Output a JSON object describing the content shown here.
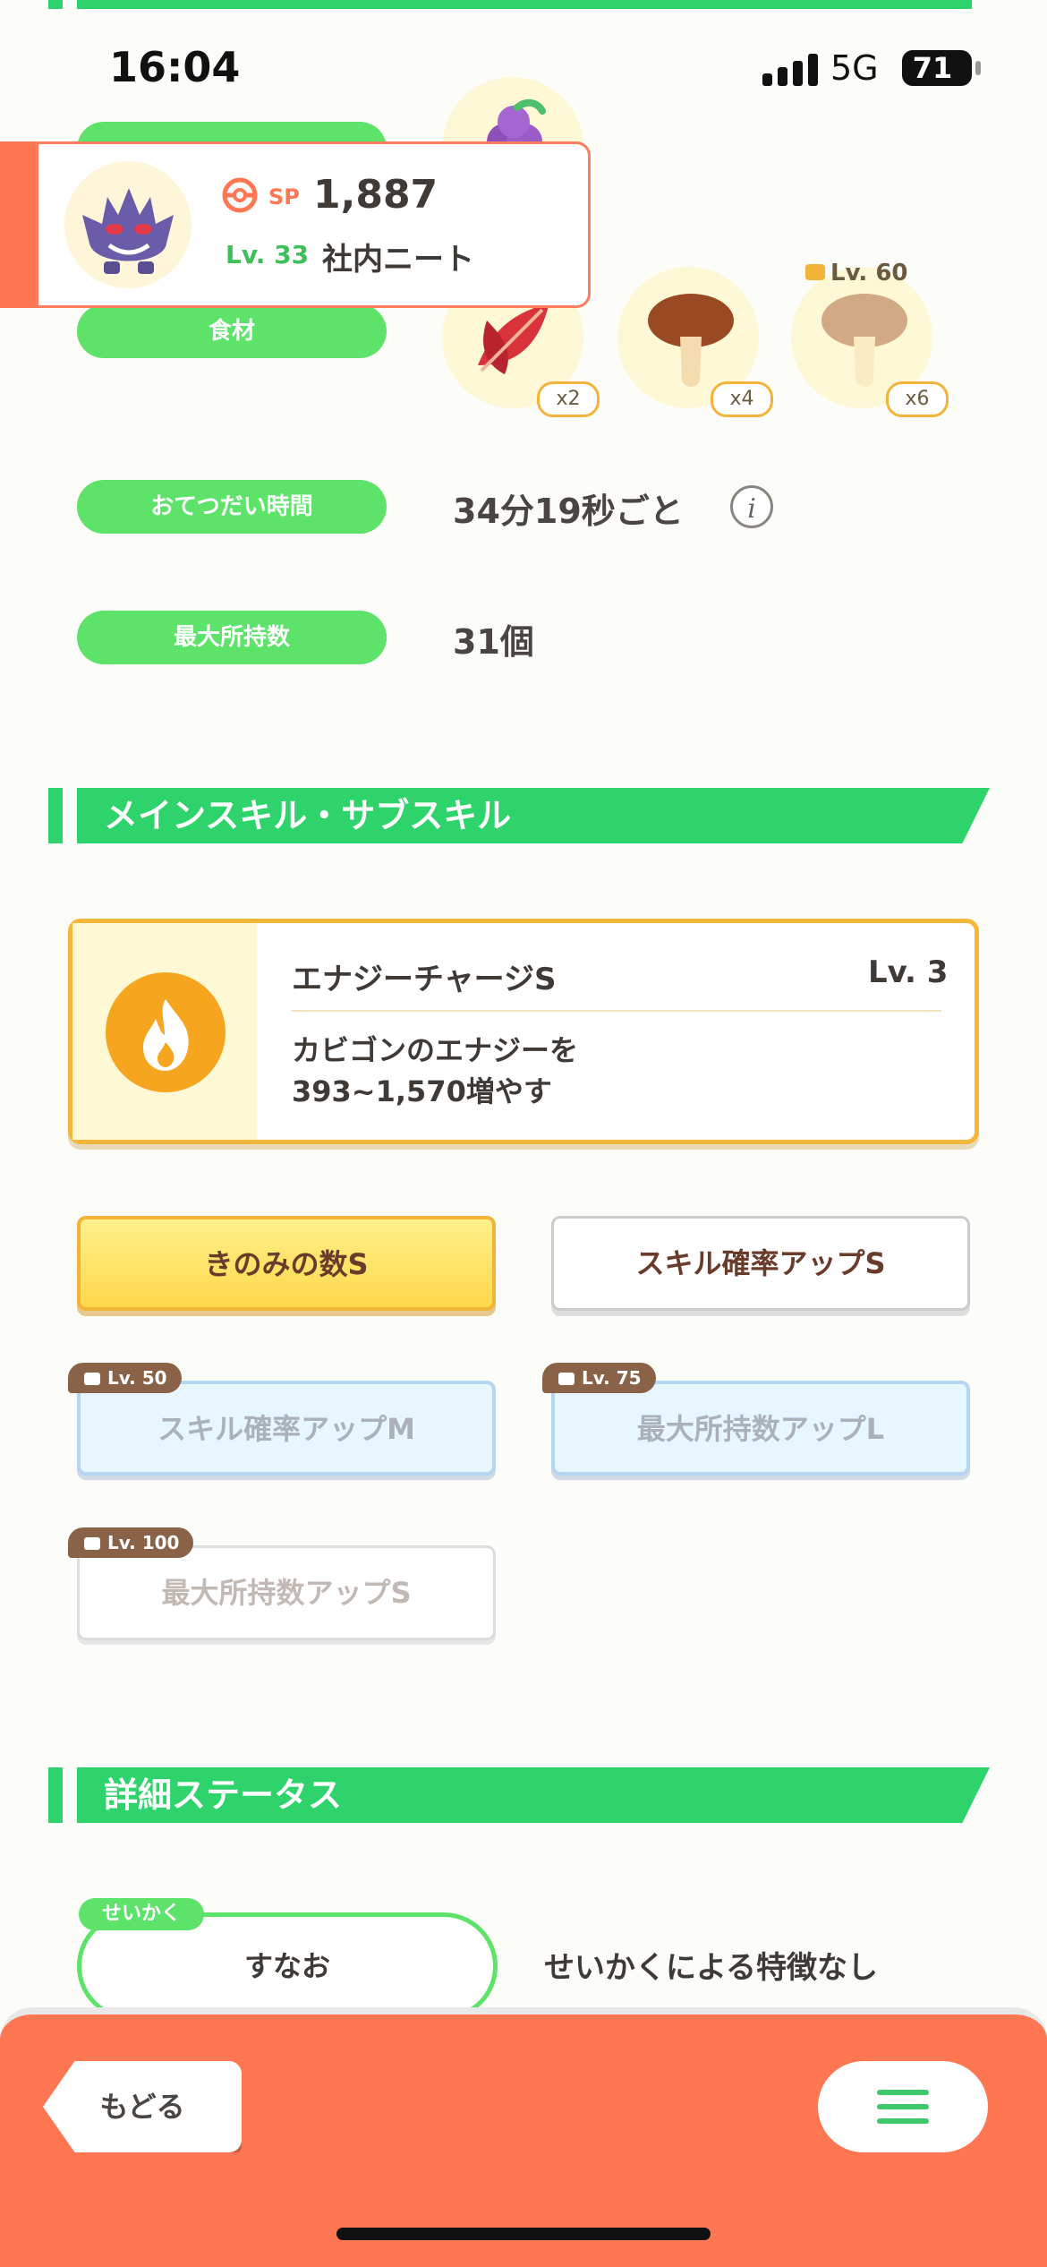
{
  "status_bar": {
    "time": "16:04",
    "network": "5G",
    "battery": "71"
  },
  "pokemon_popup": {
    "sp_label": "SP",
    "sp_value": "1,887",
    "level": "Lv. 33",
    "name": "社内ニート",
    "avatar_icon": "gengar-icon"
  },
  "stats": {
    "ingredients_label": "食材",
    "ingredients": [
      {
        "icon": "red-leaf-icon",
        "qty": "x2"
      },
      {
        "icon": "mushroom-icon",
        "qty": "x4"
      },
      {
        "icon": "mushroom-icon",
        "qty": "x6",
        "locked_level": "Lv. 60"
      }
    ],
    "help_time_label": "おてつだい時間",
    "help_time_value": "34分19秒ごと",
    "max_carry_label": "最大所持数",
    "max_carry_value": "31個"
  },
  "skills_section": {
    "title": "メインスキル・サブスキル",
    "main_skill": {
      "name": "エナジーチャージS",
      "level": "Lv. 3",
      "desc_line1": "カビゴンのエナジーを",
      "desc_line2": "393~1,570増やす",
      "icon": "flame-icon"
    },
    "sub_skills": {
      "s1": "きのみの数S",
      "s2": "スキル確率アップS",
      "s3": "スキル確率アップM",
      "s3_lv": "Lv. 50",
      "s4": "最大所持数アップL",
      "s4_lv": "Lv. 75",
      "s5": "最大所持数アップS",
      "s5_lv": "Lv. 100"
    }
  },
  "details_section": {
    "title": "詳細ステータス",
    "nature_tag": "せいかく",
    "nature_value": "すなお",
    "nature_desc": "せいかくによる特徴なし"
  },
  "bottom_nav": {
    "back_label": "もどる",
    "menu_icon": "hamburger-menu-icon"
  },
  "colors": {
    "accent_green": "#2fd36b",
    "accent_orange": "#ff7653",
    "gold": "#f5b63a"
  }
}
